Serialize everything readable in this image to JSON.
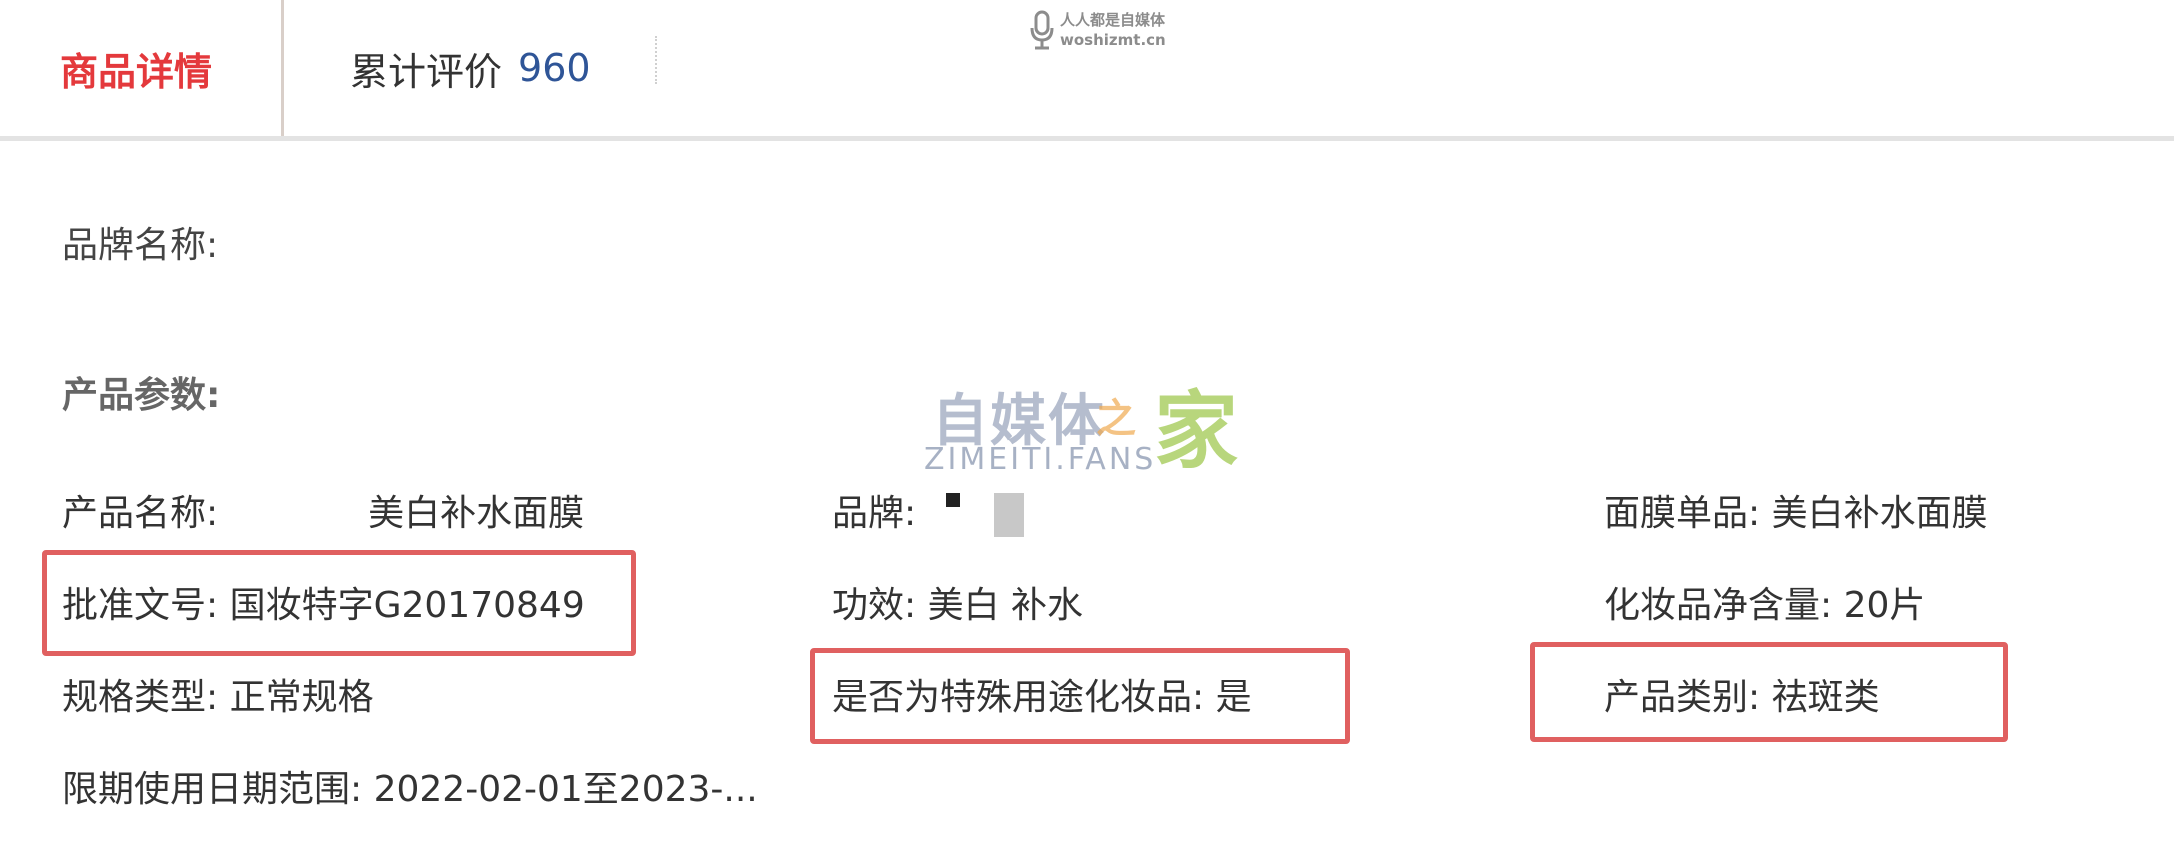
{
  "tabs": {
    "details_label": "商品详情",
    "reviews_label": "累计评价",
    "reviews_count": "960"
  },
  "watermark": {
    "top_line1": "人人都是自媒体",
    "top_line2": "woshizmt.cn",
    "logo_cn": "自媒体",
    "logo_zhi": "之",
    "logo_jia": "家",
    "logo_en": "ZIMEITI.FANS"
  },
  "brand_section": {
    "label": "品牌名称:"
  },
  "params_section": {
    "label": "产品参数:"
  },
  "specs": {
    "product_name_label": "产品名称:",
    "product_name_value": "美白补水面膜",
    "brand_label": "品牌:",
    "mask_single_label": "面膜单品:",
    "mask_single_value": "美白补水面膜",
    "approval_label": "批准文号:",
    "approval_value": "国妆特字G20170849",
    "effect_label": "功效:",
    "effect_value": "美白 补水",
    "net_content_label": "化妆品净含量:",
    "net_content_value": "20片",
    "spec_type_label": "规格类型:",
    "spec_type_value": "正常规格",
    "special_use_label": "是否为特殊用途化妆品:",
    "special_use_value": "是",
    "category_label": "产品类别:",
    "category_value": "祛斑类",
    "expiry_label": "限期使用日期范围:",
    "expiry_value": "2022-02-01至2023-..."
  },
  "colors": {
    "active_tab": "#e4393c",
    "review_count": "#2f5597",
    "highlight_border": "#e06060"
  }
}
